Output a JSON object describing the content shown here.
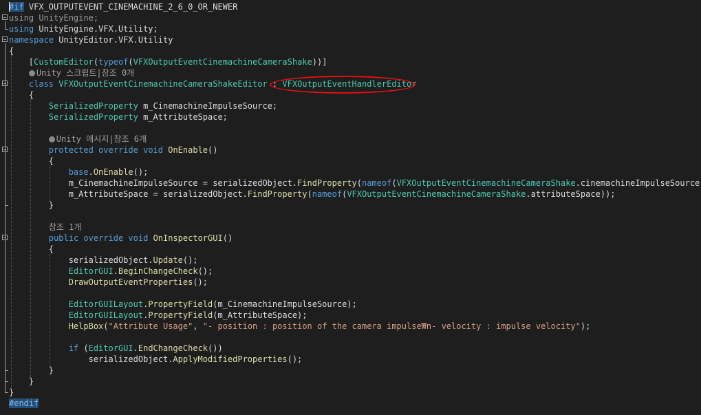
{
  "lines": [
    {
      "fold": false,
      "segs": [
        {
          "c": "ppbox",
          "t": "#if"
        },
        {
          "c": "",
          "t": " VFX_OUTPUTEVENT_CINEMACHINE_2_6_0_OR_NEWER"
        }
      ]
    },
    {
      "fold": true,
      "segs": [
        {
          "c": "kw dim",
          "t": "using"
        },
        {
          "c": "dim",
          "t": " UnityEngine;"
        }
      ]
    },
    {
      "fold": false,
      "segs": [
        {
          "c": "kw",
          "t": "using"
        },
        {
          "c": "",
          "t": " UnityEngine.VFX.Utility;"
        }
      ]
    },
    {
      "fold": true,
      "segs": [
        {
          "c": "kw",
          "t": "namespace"
        },
        {
          "c": "",
          "t": " UnityEditor.VFX.Utility"
        }
      ]
    },
    {
      "fold": false,
      "segs": [
        {
          "c": "",
          "t": "{"
        }
      ]
    },
    {
      "fold": false,
      "segs": [
        {
          "c": "",
          "t": "    ["
        },
        {
          "c": "ty",
          "t": "CustomEditor"
        },
        {
          "c": "",
          "t": "("
        },
        {
          "c": "kw",
          "t": "typeof"
        },
        {
          "c": "",
          "t": "("
        },
        {
          "c": "ty",
          "t": "VFXOutputEventCinemachineCameraShake"
        },
        {
          "c": "",
          "t": "))]"
        }
      ]
    },
    {
      "fold": false,
      "lens": true,
      "segs": [
        {
          "c": "lens",
          "t": "    "
        },
        {
          "c": "lens-icon",
          "t": ""
        },
        {
          "c": "lens",
          "t": "Unity 스크립트|참조 0개"
        }
      ]
    },
    {
      "fold": true,
      "segs": [
        {
          "c": "",
          "t": "    "
        },
        {
          "c": "kw",
          "t": "class"
        },
        {
          "c": "",
          "t": " "
        },
        {
          "c": "ty",
          "t": "VFXOutputEventCinemachineCameraShakeEditor"
        },
        {
          "c": "",
          "t": " : "
        },
        {
          "c": "ty",
          "t": "VFXOutputEventHandlerEditor"
        }
      ]
    },
    {
      "fold": false,
      "segs": [
        {
          "c": "",
          "t": "    {"
        }
      ]
    },
    {
      "fold": false,
      "segs": [
        {
          "c": "",
          "t": "        "
        },
        {
          "c": "ty",
          "t": "SerializedProperty"
        },
        {
          "c": "",
          "t": " m_CinemachineImpulseSource;"
        }
      ]
    },
    {
      "fold": false,
      "segs": [
        {
          "c": "",
          "t": "        "
        },
        {
          "c": "ty",
          "t": "SerializedProperty"
        },
        {
          "c": "",
          "t": " m_AttributeSpace;"
        }
      ]
    },
    {
      "fold": false,
      "segs": [
        {
          "c": "",
          "t": ""
        }
      ]
    },
    {
      "fold": false,
      "lens": true,
      "segs": [
        {
          "c": "lens",
          "t": "        "
        },
        {
          "c": "lens-icon",
          "t": ""
        },
        {
          "c": "lens",
          "t": "Unity 메시지|참조 6개"
        }
      ]
    },
    {
      "fold": true,
      "segs": [
        {
          "c": "",
          "t": "        "
        },
        {
          "c": "kw",
          "t": "protected"
        },
        {
          "c": "",
          "t": " "
        },
        {
          "c": "kw",
          "t": "override"
        },
        {
          "c": "",
          "t": " "
        },
        {
          "c": "kw",
          "t": "void"
        },
        {
          "c": "",
          "t": " "
        },
        {
          "c": "fn",
          "t": "OnEnable"
        },
        {
          "c": "",
          "t": "()"
        }
      ]
    },
    {
      "fold": false,
      "segs": [
        {
          "c": "",
          "t": "        {"
        }
      ]
    },
    {
      "fold": false,
      "segs": [
        {
          "c": "",
          "t": "            "
        },
        {
          "c": "kw",
          "t": "base"
        },
        {
          "c": "",
          "t": "."
        },
        {
          "c": "fn",
          "t": "OnEnable"
        },
        {
          "c": "",
          "t": "();"
        }
      ]
    },
    {
      "fold": false,
      "segs": [
        {
          "c": "",
          "t": "            m_CinemachineImpulseSource = serializedObject."
        },
        {
          "c": "fn",
          "t": "FindProperty"
        },
        {
          "c": "",
          "t": "("
        },
        {
          "c": "kw",
          "t": "nameof"
        },
        {
          "c": "",
          "t": "("
        },
        {
          "c": "ty",
          "t": "VFXOutputEventCinemachineCameraShake"
        },
        {
          "c": "",
          "t": ".cinemachineImpulseSource));"
        }
      ]
    },
    {
      "fold": false,
      "segs": [
        {
          "c": "",
          "t": "            m_AttributeSpace = serializedObject."
        },
        {
          "c": "fn",
          "t": "FindProperty"
        },
        {
          "c": "",
          "t": "("
        },
        {
          "c": "kw",
          "t": "nameof"
        },
        {
          "c": "",
          "t": "("
        },
        {
          "c": "ty",
          "t": "VFXOutputEventCinemachineCameraShake"
        },
        {
          "c": "",
          "t": ".attributeSpace));"
        }
      ]
    },
    {
      "fold": false,
      "segs": [
        {
          "c": "",
          "t": "        }"
        }
      ]
    },
    {
      "fold": false,
      "segs": [
        {
          "c": "",
          "t": ""
        }
      ]
    },
    {
      "fold": false,
      "lens": true,
      "segs": [
        {
          "c": "lens",
          "t": "        참조 1개"
        }
      ]
    },
    {
      "fold": true,
      "segs": [
        {
          "c": "",
          "t": "        "
        },
        {
          "c": "kw",
          "t": "public"
        },
        {
          "c": "",
          "t": " "
        },
        {
          "c": "kw",
          "t": "override"
        },
        {
          "c": "",
          "t": " "
        },
        {
          "c": "kw",
          "t": "void"
        },
        {
          "c": "",
          "t": " "
        },
        {
          "c": "fn",
          "t": "OnInspectorGUI"
        },
        {
          "c": "",
          "t": "()"
        }
      ]
    },
    {
      "fold": false,
      "segs": [
        {
          "c": "",
          "t": "        {"
        }
      ]
    },
    {
      "fold": false,
      "segs": [
        {
          "c": "",
          "t": "            serializedObject."
        },
        {
          "c": "fn",
          "t": "Update"
        },
        {
          "c": "",
          "t": "();"
        }
      ]
    },
    {
      "fold": false,
      "segs": [
        {
          "c": "",
          "t": "            "
        },
        {
          "c": "ty",
          "t": "EditorGUI"
        },
        {
          "c": "",
          "t": "."
        },
        {
          "c": "fn",
          "t": "BeginChangeCheck"
        },
        {
          "c": "",
          "t": "();"
        }
      ]
    },
    {
      "fold": false,
      "segs": [
        {
          "c": "",
          "t": "            "
        },
        {
          "c": "fn",
          "t": "DrawOutputEventProperties"
        },
        {
          "c": "",
          "t": "();"
        }
      ]
    },
    {
      "fold": false,
      "segs": [
        {
          "c": "",
          "t": ""
        }
      ]
    },
    {
      "fold": false,
      "segs": [
        {
          "c": "",
          "t": "            "
        },
        {
          "c": "ty",
          "t": "EditorGUILayout"
        },
        {
          "c": "",
          "t": "."
        },
        {
          "c": "fn",
          "t": "PropertyField"
        },
        {
          "c": "",
          "t": "(m_CinemachineImpulseSource);"
        }
      ]
    },
    {
      "fold": false,
      "segs": [
        {
          "c": "",
          "t": "            "
        },
        {
          "c": "ty",
          "t": "EditorGUILayout"
        },
        {
          "c": "",
          "t": "."
        },
        {
          "c": "fn",
          "t": "PropertyField"
        },
        {
          "c": "",
          "t": "(m_AttributeSpace);"
        }
      ]
    },
    {
      "fold": false,
      "segs": [
        {
          "c": "",
          "t": "            "
        },
        {
          "c": "fn",
          "t": "HelpBox"
        },
        {
          "c": "",
          "t": "("
        },
        {
          "c": "str",
          "t": "\"Attribute Usage\""
        },
        {
          "c": "",
          "t": ", "
        },
        {
          "c": "str",
          "t": "\"- position : position of the camera impulse₩n- velocity : impulse velocity\""
        },
        {
          "c": "",
          "t": ");"
        }
      ]
    },
    {
      "fold": false,
      "segs": [
        {
          "c": "",
          "t": ""
        }
      ]
    },
    {
      "fold": false,
      "segs": [
        {
          "c": "",
          "t": "            "
        },
        {
          "c": "kw",
          "t": "if"
        },
        {
          "c": "",
          "t": " ("
        },
        {
          "c": "ty",
          "t": "EditorGUI"
        },
        {
          "c": "",
          "t": "."
        },
        {
          "c": "fn",
          "t": "EndChangeCheck"
        },
        {
          "c": "",
          "t": "())"
        }
      ]
    },
    {
      "fold": false,
      "segs": [
        {
          "c": "",
          "t": "                serializedObject."
        },
        {
          "c": "fn",
          "t": "ApplyModifiedProperties"
        },
        {
          "c": "",
          "t": "();"
        }
      ]
    },
    {
      "fold": false,
      "segs": [
        {
          "c": "",
          "t": "        }"
        }
      ]
    },
    {
      "fold": false,
      "segs": [
        {
          "c": "",
          "t": "    }"
        }
      ]
    },
    {
      "fold": false,
      "segs": [
        {
          "c": "",
          "t": "}"
        }
      ]
    },
    {
      "fold": false,
      "segs": [
        {
          "c": "ppbox",
          "t": "#endif"
        }
      ]
    }
  ],
  "theme": {
    "background": "#1e1e1e",
    "keyword": "#569cd6",
    "type": "#4ec9b0",
    "method": "#dcdcaa",
    "string": "#d69d85",
    "annotation": "#e01010"
  }
}
